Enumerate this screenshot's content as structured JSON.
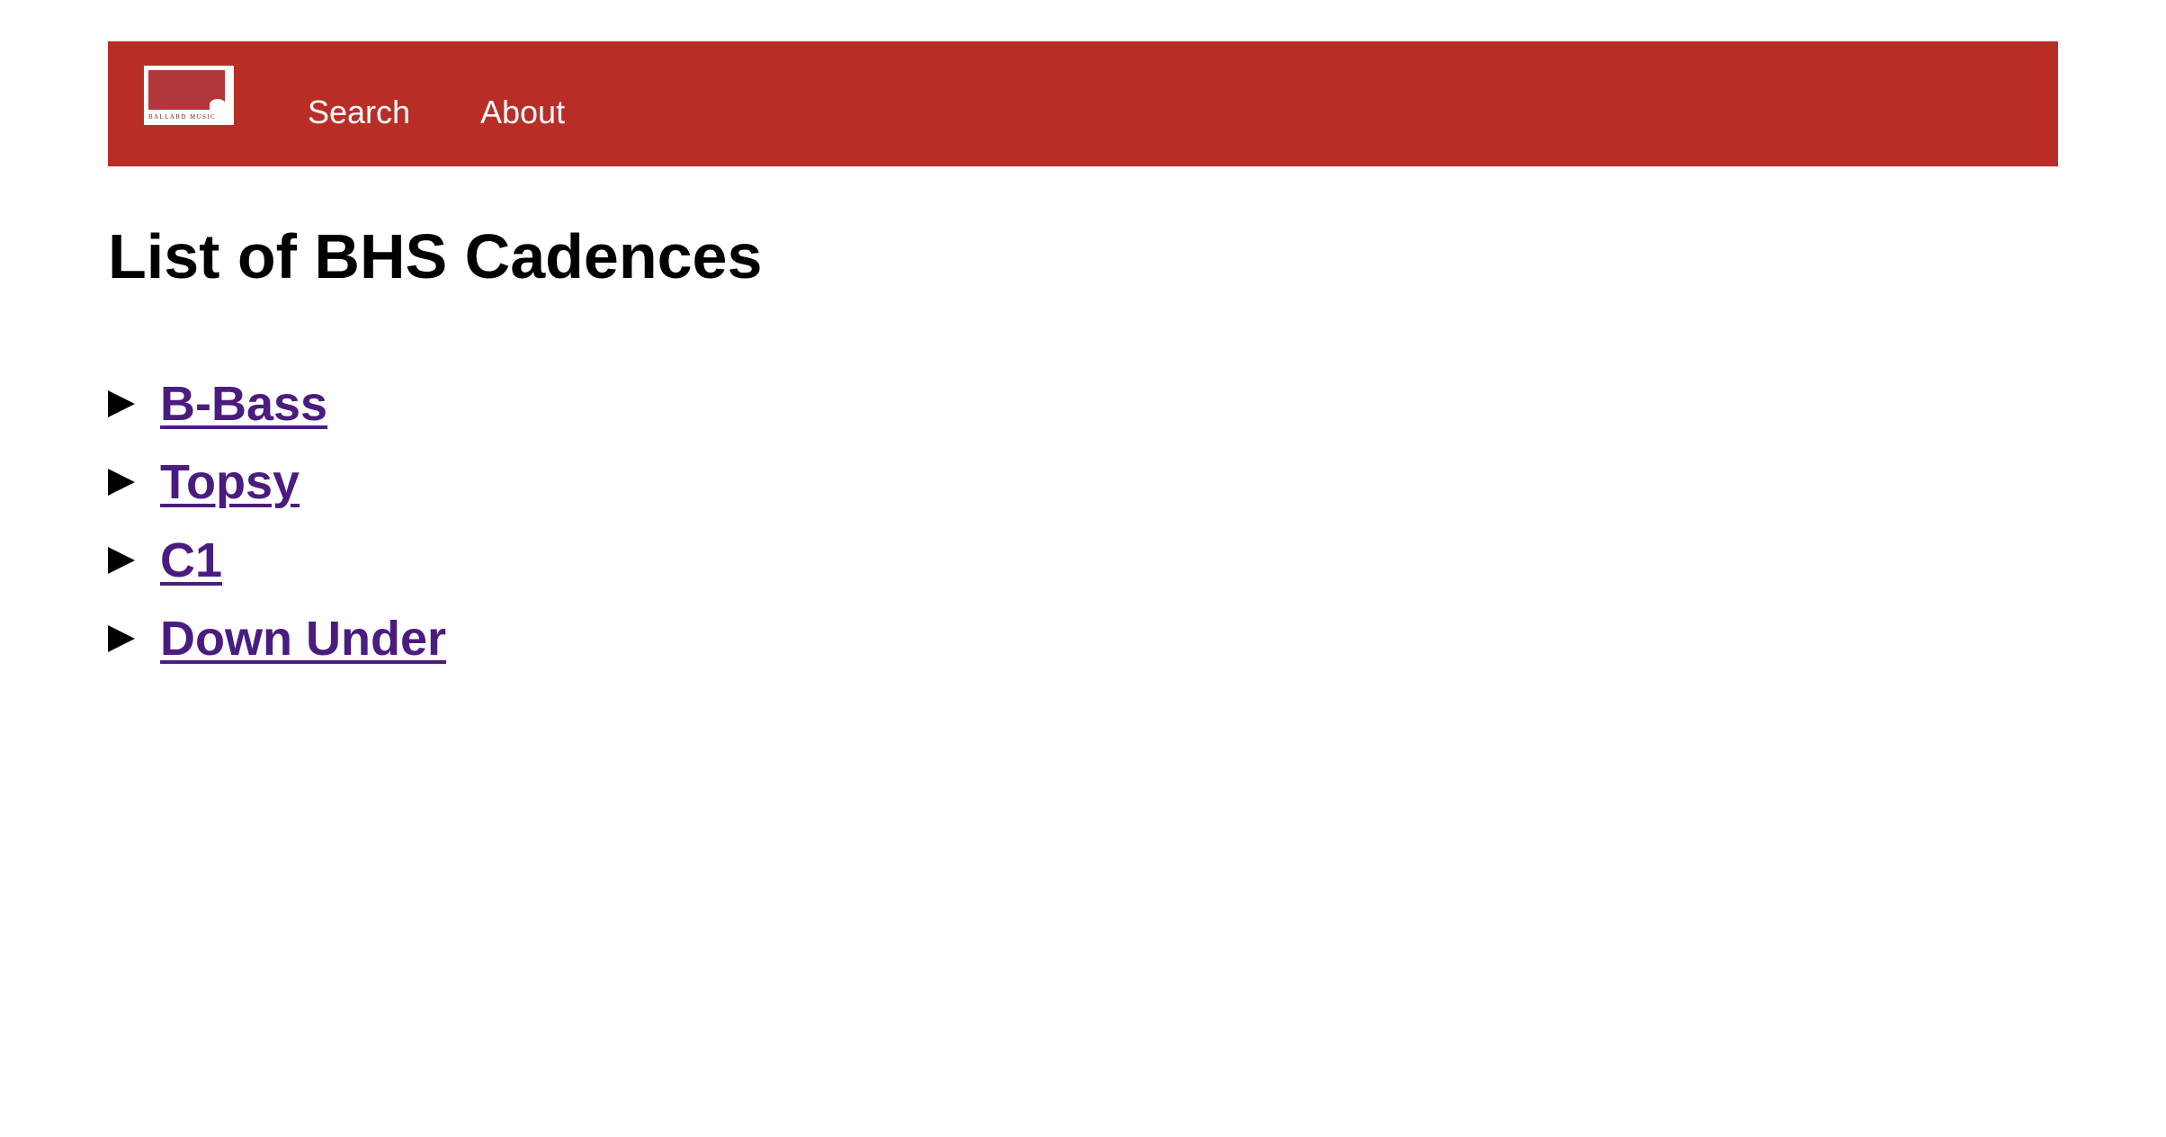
{
  "nav": {
    "logo_text": "BALLARD MUSIC",
    "links": [
      {
        "label": "Search"
      },
      {
        "label": "About"
      }
    ],
    "bar_color": "#b82e27"
  },
  "page": {
    "title": "List of BHS Cadences"
  },
  "cadences": [
    {
      "label": "B-Bass"
    },
    {
      "label": "Topsy"
    },
    {
      "label": "C1"
    },
    {
      "label": "Down Under"
    }
  ],
  "colors": {
    "link": "#4b1c80",
    "text": "#000000"
  }
}
